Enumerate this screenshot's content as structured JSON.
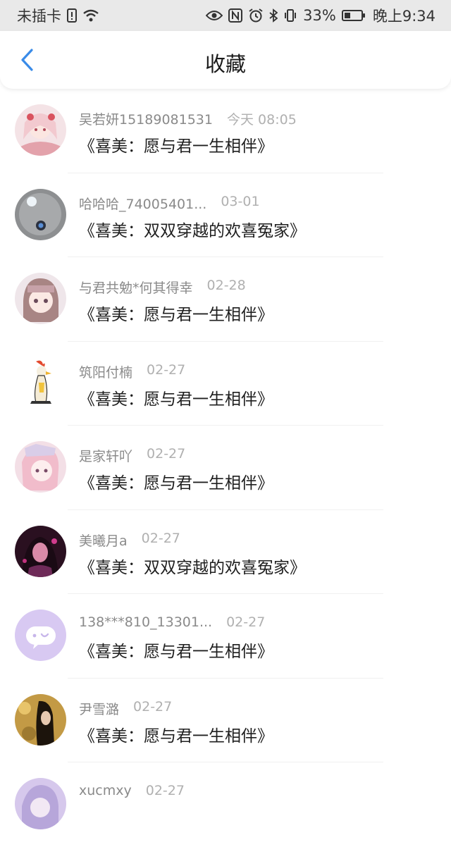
{
  "status_bar": {
    "carrier": "未插卡",
    "battery": "33%",
    "time": "晚上9:34"
  },
  "header": {
    "title": "收藏"
  },
  "colors": {
    "accent": "#3a8be8"
  },
  "list": [
    {
      "name": "吴若妍15189081531",
      "date": "今天 08:05",
      "book": "《喜美：愿与君一生相伴》"
    },
    {
      "name": "哈哈哈_74005401...",
      "date": "03-01",
      "book": "《喜美：双双穿越的欢喜冤家》"
    },
    {
      "name": "与君共勉*何其得幸",
      "date": "02-28",
      "book": "《喜美：愿与君一生相伴》"
    },
    {
      "name": "筑阳付楠",
      "date": "02-27",
      "book": "《喜美：愿与君一生相伴》"
    },
    {
      "name": "是家轩吖",
      "date": "02-27",
      "book": "《喜美：愿与君一生相伴》"
    },
    {
      "name": "美曦月a",
      "date": "02-27",
      "book": "《喜美：双双穿越的欢喜冤家》"
    },
    {
      "name": "138***810_13301...",
      "date": "02-27",
      "book": "《喜美：愿与君一生相伴》"
    },
    {
      "name": "尹雪潞",
      "date": "02-27",
      "book": "《喜美：愿与君一生相伴》"
    },
    {
      "name": "xucmxy",
      "date": "02-27",
      "book": ""
    }
  ]
}
